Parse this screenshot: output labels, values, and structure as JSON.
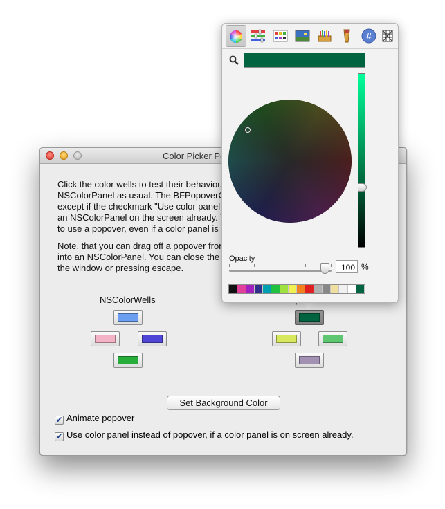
{
  "window": {
    "title": "Color Picker Popover",
    "paragraph1": "Click the color wells to test their behaviour. On the left side they will use an NSColorPanel as usual. The BFPopoverColorWells on the right use a popover, except if the checkmark \"Use color panel instead of popover\" is set and there is an NSColorPanel on the screen already. You can double click them to force them to use a popover, even if a color panel is visible.",
    "paragraph2": "Note, that you can drag off a popover from the color wells and it will transform into an NSColorPanel. You can close the popover by clicking anywhere else in the window or pressing escape.",
    "left_column_label": "NSColorWells",
    "right_column_label": "BFPopoverColorWells"
  },
  "wells_left": {
    "top": "#6b9ef0",
    "left": "#f3b3c4",
    "right": "#5046d6",
    "bottom": "#26ad3a"
  },
  "wells_right": {
    "top": "#006440",
    "left": "#d7e85c",
    "right": "#5ec671",
    "bottom": "#a391b3"
  },
  "buttons": {
    "set_background": "Set Background Color"
  },
  "checkboxes": {
    "animate": {
      "label": "Animate popover",
      "checked": true,
      "mark": "✔"
    },
    "use_panel": {
      "label": "Use color panel instead of popover, if a color panel is on screen already.",
      "checked": true,
      "mark": "✔"
    }
  },
  "popover": {
    "toolbar_icons": [
      "color-wheel-icon",
      "color-sliders-icon",
      "color-palettes-icon",
      "image-palettes-icon",
      "crayons-icon",
      "pencils-icon",
      "hex-color-icon",
      "web-palette-icon"
    ],
    "hex_glyph": "#",
    "selected_color": "#006440",
    "opacity_label": "Opacity",
    "opacity_value": "100",
    "opacity_unit": "%",
    "opacity_level": 1.0,
    "swatches": [
      "#111111",
      "#e0409a",
      "#a020c0",
      "#30308a",
      "#00a0b0",
      "#20c040",
      "#a0e040",
      "#f0f050",
      "#f08020",
      "#e02020",
      "#b0b0b0",
      "#888888",
      "#f0e0a0",
      "#f0f0f0",
      "#ffffff",
      "#006440"
    ]
  }
}
